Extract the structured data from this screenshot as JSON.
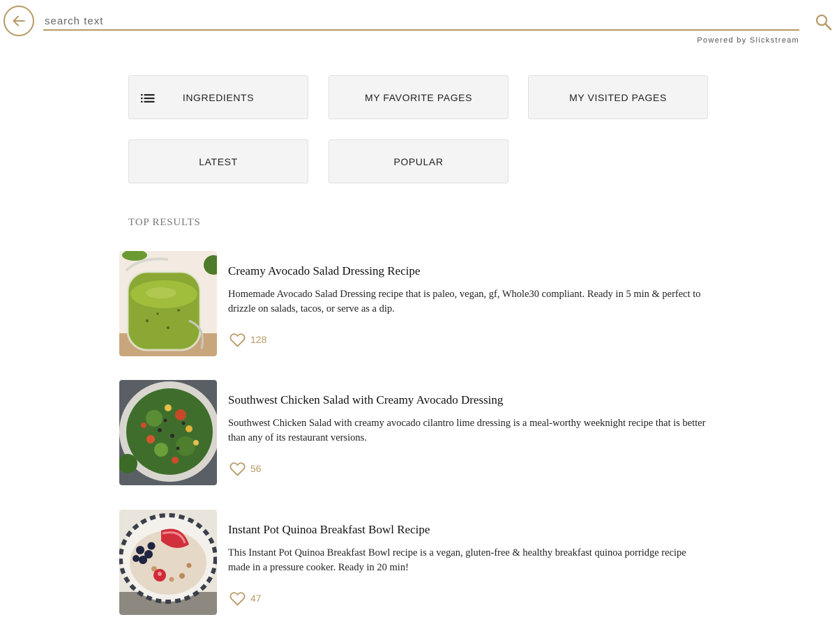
{
  "search": {
    "placeholder": "search text",
    "value": ""
  },
  "powered_by": "Powered by Slickstream",
  "nav_buttons": {
    "ingredients": "INGREDIENTS",
    "favorites": "MY FAVORITE PAGES",
    "visited": "MY VISITED PAGES",
    "latest": "LATEST",
    "popular": "POPULAR"
  },
  "section_label": "TOP RESULTS",
  "results": [
    {
      "title": "Creamy Avocado Salad Dressing Recipe",
      "description": "Homemade Avocado Salad Dressing recipe that is paleo, vegan, gf, Whole30 compliant. Ready in 5 min & perfect to drizzle on salads, tacos, or serve as a dip.",
      "likes": "128"
    },
    {
      "title": "Southwest Chicken Salad with Creamy Avocado Dressing",
      "description": "Southwest Chicken Salad with creamy avocado cilantro lime dressing is a meal-worthy weeknight recipe that is better than any of its restaurant versions.",
      "likes": "56"
    },
    {
      "title": "Instant Pot Quinoa Breakfast Bowl Recipe",
      "description": "This Instant Pot Quinoa Breakfast Bowl recipe is a vegan, gluten-free & healthy breakfast quinoa porridge recipe made in a pressure cooker. Ready in 20 min!",
      "likes": "47"
    }
  ],
  "icons": {
    "back": "arrow-left-circle-icon",
    "search": "magnifier-icon",
    "list": "list-icon",
    "like": "heart-outline-icon"
  },
  "colors": {
    "accent": "#b79a66",
    "button_bg": "#f4f4f4",
    "button_border": "#e0e0e0",
    "text": "#222222"
  }
}
